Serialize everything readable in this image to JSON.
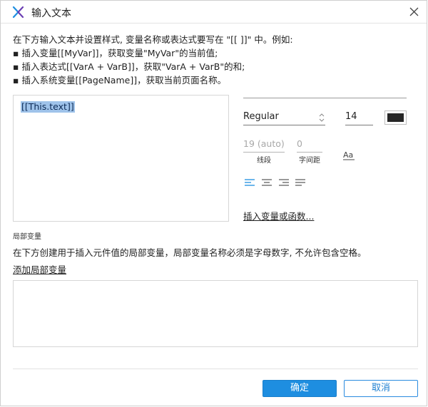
{
  "window": {
    "title": "输入文本",
    "accent_color": "#1e8ee0"
  },
  "instructions": {
    "line1": "在下方输入文本并设置样式, 变量名称或表达式要写在 \"[[ ]]\" 中。例如:",
    "line2": "▪ 插入变量[[MyVar]]，获取变量\"MyVar\"的当前值;",
    "line3": "▪ 插入表达式[[VarA + VarB]]，获取\"VarA + VarB\"的和;",
    "line4": "▪ 插入系统变量[[PageName]]，获取当前页面名称。"
  },
  "editor": {
    "text": "[[This.text]]",
    "selection_color": "#9fc3ea"
  },
  "style": {
    "font_style": "Regular",
    "font_size": "14",
    "text_color": "#262626",
    "line_spacing_placeholder": "19 (auto)",
    "line_spacing_label": "线段",
    "char_spacing_placeholder": "0",
    "char_spacing_label": "字间距",
    "text_case_glyph": "Aa",
    "insert_link": "插入变量或函数..."
  },
  "alignment": {
    "active_color": "#1e8ee0",
    "inactive_color": "#555555",
    "items": [
      "align-left",
      "align-center",
      "align-right",
      "align-justify"
    ]
  },
  "local_vars": {
    "heading": "局部变量",
    "description": "在下方创建用于插入元件值的局部变量，局部变量名称必须是字母数字, 不允许包含空格。",
    "add_link": "添加局部变量"
  },
  "footer": {
    "ok_label": "确定",
    "cancel_label": "取消"
  }
}
